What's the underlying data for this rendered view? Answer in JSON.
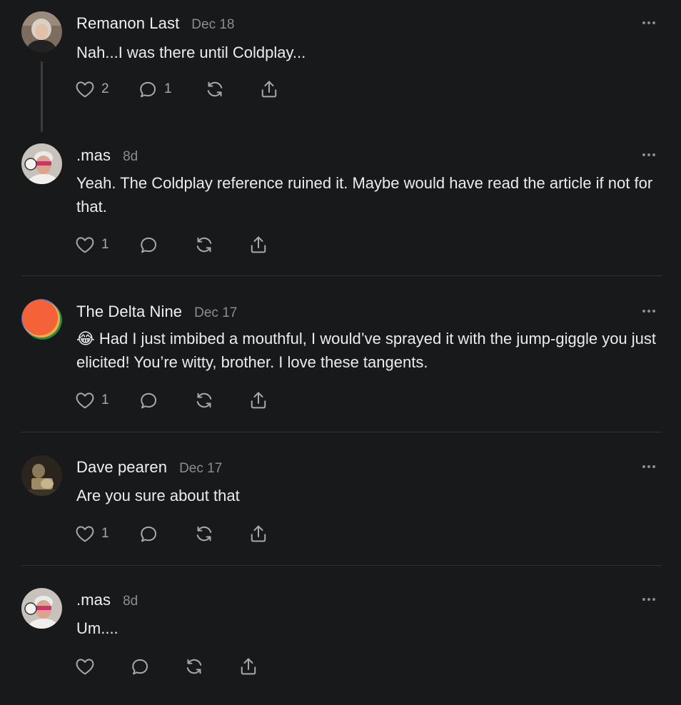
{
  "comments": [
    {
      "author": "Remanon Last",
      "date": "Dec 18",
      "text": "Nah...I was there until Coldplay...",
      "likes": "2",
      "replies": "1"
    },
    {
      "author": ".mas",
      "date": "8d",
      "text": "Yeah. The Coldplay reference ruined it. Maybe would have read the article if not for that.",
      "likes": "1",
      "replies": ""
    },
    {
      "author": "The Delta Nine",
      "date": "Dec 17",
      "emoji": "😂",
      "text": "Had I just imbibed a mouthful, I would’ve sprayed it with the jump-giggle you just elicited! You’re witty, brother. I love these tangents.",
      "likes": "1",
      "replies": ""
    },
    {
      "author": "Dave pearen",
      "date": "Dec 17",
      "text": "Are you sure about that",
      "likes": "1",
      "replies": ""
    },
    {
      "author": ".mas",
      "date": "8d",
      "text": "Um....",
      "likes": "",
      "replies": ""
    }
  ],
  "icons": {
    "like": "heart-icon",
    "reply": "comment-icon",
    "restack": "restack-icon",
    "share": "share-icon",
    "more": "more-icon"
  },
  "colors": {
    "background": "#18191b",
    "text": "#ececec",
    "muted": "#8c8d8f",
    "divider": "#2f3032",
    "delta_avatar": "#f4623a"
  }
}
